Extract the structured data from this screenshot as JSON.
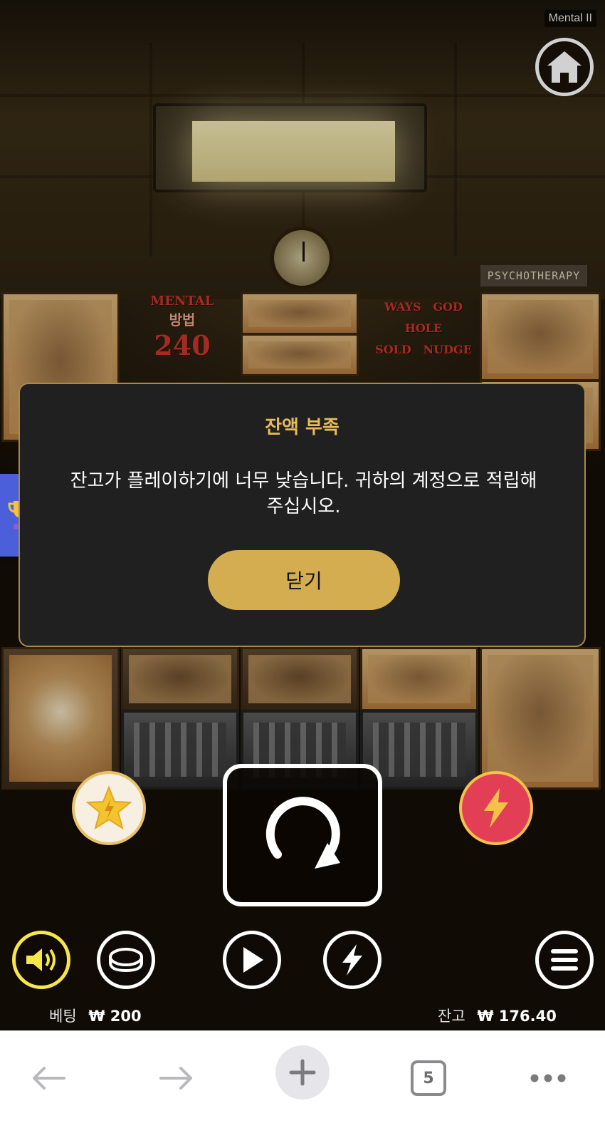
{
  "game": {
    "title": "Mental II",
    "wall_sign": "PSYCHOTHERAPY",
    "banner_left": {
      "brand": "MENTAL",
      "label": "방법",
      "ways": "240"
    },
    "banner_right": {
      "top_left": "WAYS",
      "top_right": "GOD",
      "middle": "HOLE",
      "bottom_left": "SOLD",
      "bottom_right": "NUDGE"
    }
  },
  "dialog": {
    "title": "잔액 부족",
    "message_line1": "잔고가 플레이하기에 너무 낮습니다. 귀하의 계정으로 적립해",
    "message_line2": "주십시오.",
    "close_label": "닫기"
  },
  "footer": {
    "bet_label": "베팅",
    "bet_value": "₩ 200",
    "balance_label": "잔고",
    "balance_value": "₩ 176.40"
  },
  "browser": {
    "tab_count": "5"
  },
  "icons": {
    "home": "home-icon",
    "trophy": "trophy-icon",
    "feature": "star-icon",
    "turbo": "lightning-icon",
    "spin": "spin-icon",
    "sound": "sound-icon",
    "coin": "coin-icon",
    "autoplay": "play-icon",
    "quick": "lightning-circle-icon",
    "menu": "menu-icon",
    "back": "back-arrow-icon",
    "forward": "forward-arrow-icon",
    "new_tab": "plus-icon",
    "tabs": "tabs-icon",
    "more": "more-icon"
  },
  "colors": {
    "dialog_title": "#e8bb5a",
    "dialog_button": "#d4ad50",
    "dialog_border": "#a98a46",
    "sound_ring": "#f5e64a",
    "turbo_red": "#e23f57",
    "trophy_tab": "#4a5fd9"
  }
}
